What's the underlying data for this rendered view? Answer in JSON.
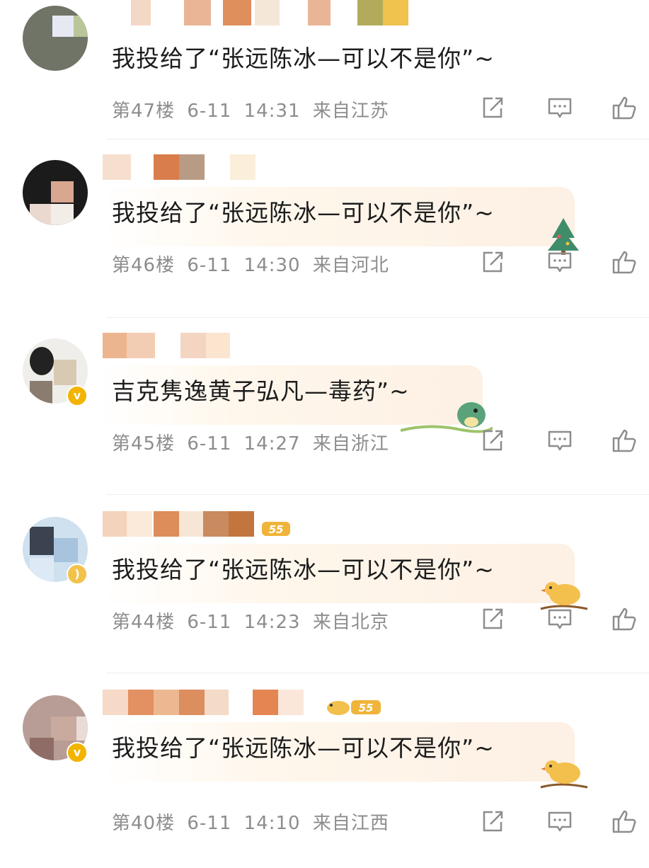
{
  "comments": [
    {
      "text": "我投给了“张远陈冰—可以不是你”~",
      "floor": "第47楼",
      "date": "6-11",
      "time": "14:31",
      "location": "来自江苏"
    },
    {
      "text": "我投给了“张远陈冰—可以不是你”~",
      "floor": "第46楼",
      "date": "6-11",
      "time": "14:30",
      "location": "来自河北"
    },
    {
      "text": "吉克隽逸黄子弘凡—毒药”~",
      "floor": "第45楼",
      "date": "6-11",
      "time": "14:27",
      "location": "来自浙江"
    },
    {
      "text": "我投给了“张远陈冰—可以不是你”~",
      "floor": "第44楼",
      "date": "6-11",
      "time": "14:23",
      "location": "来自北京"
    },
    {
      "text": "我投给了“张远陈冰—可以不是你”~",
      "floor": "第40楼",
      "date": "6-11",
      "time": "14:10",
      "location": "来自江西"
    }
  ],
  "badges": {
    "level_badge": "55"
  },
  "icons": {
    "share": "share-icon",
    "reply": "comment-icon",
    "like": "thumbs-up-icon",
    "verified": "verified-badge-icon"
  }
}
